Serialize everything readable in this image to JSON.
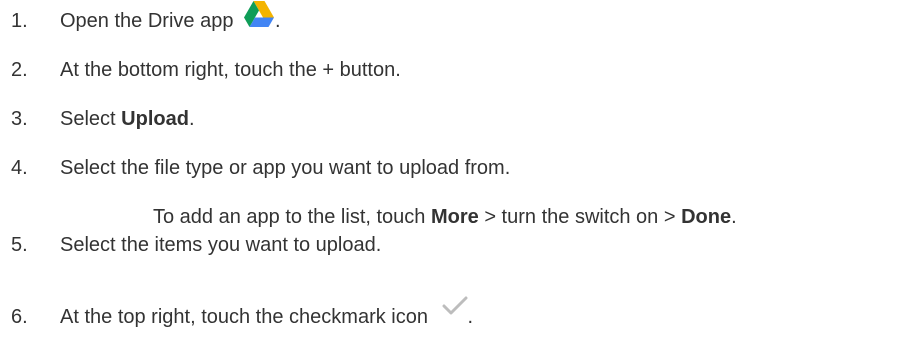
{
  "steps": [
    {
      "number": "1.",
      "text": "Open the Drive app",
      "icon": "google-drive-icon",
      "after": "."
    },
    {
      "number": "2.",
      "text": "At the bottom right, touch the + button."
    },
    {
      "number": "3.",
      "before": "Select ",
      "bold": "Upload",
      "after": "."
    },
    {
      "number": "4.",
      "text": "Select the file type or app you want to upload from.",
      "note": {
        "before": "To add an app to the list, touch ",
        "bold1": "More",
        "middle": " > turn the switch on > ",
        "bold2": "Done",
        "after": "."
      }
    },
    {
      "number": "5.",
      "text": "Select the items you want to upload."
    },
    {
      "number": "6.",
      "text": "At the top right, touch the checkmark icon",
      "icon": "checkmark-icon",
      "after": "."
    }
  ],
  "colors": {
    "text": "#333333",
    "drive_green": "#0F9D58",
    "drive_yellow": "#F4B400",
    "drive_blue": "#4285F4",
    "checkmark": "#BDBDBD"
  }
}
